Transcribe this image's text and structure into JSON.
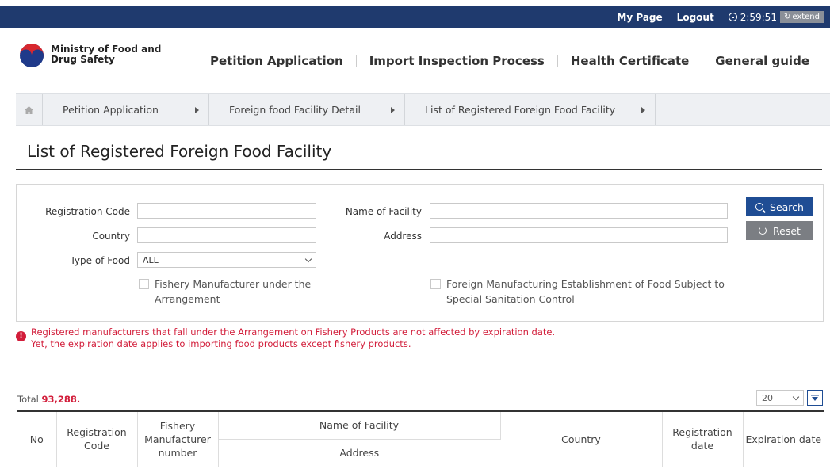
{
  "topbar": {
    "my_page": "My Page",
    "logout": "Logout",
    "timer": "2:59:51",
    "extend": "extend",
    "bg_color": "#1f3a6e"
  },
  "logo": {
    "line1": "Ministry of Food and",
    "line2": "Drug Safety"
  },
  "nav": {
    "items": [
      "Petition Application",
      "Import Inspection Process",
      "Health Certificate",
      "General guide"
    ]
  },
  "breadcrumb": {
    "home_icon": "home-icon",
    "items": [
      "Petition Application",
      "Foreign food Facility Detail",
      "List of Registered Foreign Food Facility"
    ]
  },
  "page": {
    "title": "List of Registered Foreign Food Facility"
  },
  "search": {
    "registration_code_label": "Registration Code",
    "registration_code_value": "",
    "name_of_facility_label": "Name of Facility",
    "name_of_facility_value": "",
    "country_label": "Country",
    "country_value": "",
    "address_label": "Address",
    "address_value": "",
    "type_of_food_label": "Type of Food",
    "type_of_food_value": "ALL",
    "checkbox1_line1": "Fishery Manufacturer under the",
    "checkbox1_line2": "Arrangement",
    "checkbox1_checked": false,
    "checkbox2_line1": "Foreign Manufacturing Establishment of Food Subject to",
    "checkbox2_line2": "Special Sanitation Control",
    "checkbox2_checked": false,
    "search_button": "Search",
    "reset_button": "Reset"
  },
  "notice": {
    "line1": "Registered manufacturers that fall under the Arrangement on Fishery Products are not affected by expiration date.",
    "line2": "Yet, the expiration date applies to importing food products except fishery products.",
    "color": "#d21d3a"
  },
  "results": {
    "total_label": "Total",
    "total_count": "93,288",
    "total_suffix": ".",
    "per_page": "20"
  },
  "table": {
    "headers": {
      "no": "No",
      "registration_code": "Registration Code",
      "fishery_number": "Fishery Manufacturer number",
      "name_of_facility": "Name of Facility",
      "address": "Address",
      "country": "Country",
      "registration_date": "Registration date",
      "expiration_date": "Expiration date"
    }
  }
}
